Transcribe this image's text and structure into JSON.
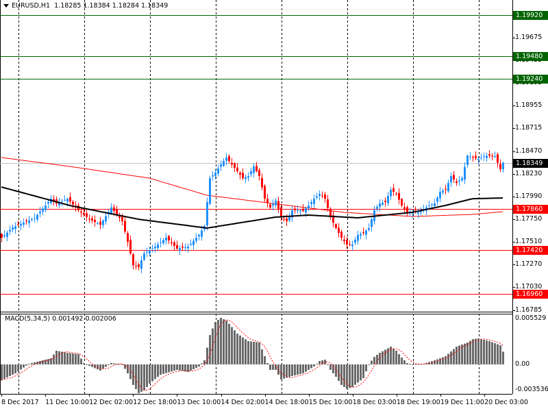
{
  "header": {
    "symbol": "EURUSD,H1",
    "ohlc": "1.18285 1.18384 1.18284 1.18349"
  },
  "chart_data": [
    {
      "type": "candlestick",
      "title": "EURUSD,H1",
      "ylim": [
        1.16785,
        1.1992
      ],
      "price_ticks": [
        "1.19675",
        "1.19435",
        "1.19195",
        "1.18955",
        "1.18715",
        "1.18470",
        "1.18230",
        "1.17990",
        "1.17750",
        "1.17510",
        "1.17270",
        "1.17030",
        "1.16785"
      ],
      "time_ticks": [
        "8 Dec 2017",
        "11 Dec 10:00",
        "12 Dec 02:00",
        "12 Dec 18:00",
        "13 Dec 10:00",
        "14 Dec 02:00",
        "14 Dec 18:00",
        "15 Dec 10:00",
        "18 Dec 03:00",
        "18 Dec 19:00",
        "19 Dec 11:00",
        "20 Dec 03:00"
      ],
      "last_price": {
        "value": 1.18349,
        "label": "1.18349",
        "color": "#000000"
      },
      "levels": [
        {
          "value": 1.1992,
          "label": "1.19920",
          "color": "#006400"
        },
        {
          "value": 1.1948,
          "label": "1.19480",
          "color": "#006400"
        },
        {
          "value": 1.1924,
          "label": "1.19240",
          "color": "#006400"
        },
        {
          "value": 1.1786,
          "label": "1.17860",
          "color": "#ff0000"
        },
        {
          "value": 1.1742,
          "label": "1.17420",
          "color": "#ff0000"
        },
        {
          "value": 1.1696,
          "label": "1.16960",
          "color": "#ff0000"
        }
      ],
      "up_color": "#1e90ff",
      "down_color": "#ff0000",
      "close_by_bar": [
        [
          0,
          1.17554
        ],
        [
          4,
          1.17663
        ],
        [
          8,
          1.17714
        ],
        [
          12,
          1.17765
        ],
        [
          16,
          1.17896
        ],
        [
          18,
          1.17968
        ],
        [
          20,
          1.17917
        ],
        [
          24,
          1.17968
        ],
        [
          28,
          1.17845
        ],
        [
          32,
          1.1775
        ],
        [
          36,
          1.17692
        ],
        [
          40,
          1.17874
        ],
        [
          44,
          1.17728
        ],
        [
          46,
          1.1751
        ],
        [
          48,
          1.17263
        ],
        [
          50,
          1.17241
        ],
        [
          52,
          1.17387
        ],
        [
          56,
          1.17459
        ],
        [
          60,
          1.17554
        ],
        [
          64,
          1.17438
        ],
        [
          68,
          1.17459
        ],
        [
          72,
          1.17583
        ],
        [
          74,
          1.17678
        ],
        [
          76,
          1.18186
        ],
        [
          78,
          1.18245
        ],
        [
          80,
          1.18332
        ],
        [
          82,
          1.18405
        ],
        [
          84,
          1.18332
        ],
        [
          86,
          1.18259
        ],
        [
          88,
          1.18186
        ],
        [
          90,
          1.18208
        ],
        [
          92,
          1.1831
        ],
        [
          94,
          1.18208
        ],
        [
          96,
          1.17968
        ],
        [
          98,
          1.17874
        ],
        [
          100,
          1.17947
        ],
        [
          102,
          1.17772
        ],
        [
          104,
          1.17728
        ],
        [
          106,
          1.17845
        ],
        [
          108,
          1.17845
        ],
        [
          110,
          1.17838
        ],
        [
          112,
          1.17896
        ],
        [
          114,
          1.17968
        ],
        [
          116,
          1.18019
        ],
        [
          118,
          1.17968
        ],
        [
          120,
          1.17772
        ],
        [
          122,
          1.17656
        ],
        [
          124,
          1.17554
        ],
        [
          126,
          1.17481
        ],
        [
          128,
          1.17481
        ],
        [
          130,
          1.17583
        ],
        [
          132,
          1.17605
        ],
        [
          134,
          1.17656
        ],
        [
          136,
          1.17845
        ],
        [
          138,
          1.17917
        ],
        [
          140,
          1.17932
        ],
        [
          142,
          1.18063
        ],
        [
          144,
          1.18019
        ],
        [
          146,
          1.17896
        ],
        [
          148,
          1.17823
        ],
        [
          150,
          1.17823
        ],
        [
          152,
          1.17823
        ],
        [
          154,
          1.17859
        ],
        [
          156,
          1.17896
        ],
        [
          158,
          1.17917
        ],
        [
          160,
          1.18041
        ],
        [
          162,
          1.18063
        ],
        [
          164,
          1.18208
        ],
        [
          166,
          1.18136
        ],
        [
          168,
          1.18186
        ],
        [
          170,
          1.18426
        ],
        [
          172,
          1.18405
        ],
        [
          174,
          1.1839
        ],
        [
          176,
          1.18419
        ],
        [
          178,
          1.18426
        ],
        [
          180,
          1.18419
        ],
        [
          182,
          1.18281
        ],
        [
          183,
          1.18349
        ]
      ],
      "ma_black": {
        "color": "#000000",
        "points": [
          [
            0,
            1.18092
          ],
          [
            25,
            1.17896
          ],
          [
            50,
            1.1775
          ],
          [
            75,
            1.17656
          ],
          [
            100,
            1.17772
          ],
          [
            112,
            1.17794
          ],
          [
            130,
            1.17765
          ],
          [
            150,
            1.17823
          ],
          [
            162,
            1.17896
          ],
          [
            172,
            1.17968
          ],
          [
            183,
            1.17976
          ]
        ]
      },
      "ma_red": {
        "color": "#ff0000",
        "points": [
          [
            0,
            1.18405
          ],
          [
            25,
            1.1831
          ],
          [
            54,
            1.18186
          ],
          [
            75,
            1.18005
          ],
          [
            105,
            1.17896
          ],
          [
            125,
            1.17823
          ],
          [
            150,
            1.17779
          ],
          [
            172,
            1.17801
          ],
          [
            183,
            1.1783
          ]
        ]
      }
    },
    {
      "type": "bar",
      "title": "MACD(5,34,5) 0.001492 0.002006",
      "ylim": [
        -0.003536,
        0.005529
      ],
      "ticks": [
        "0.005529",
        "0.00",
        "-0.003536"
      ],
      "histogram_color": "#696969",
      "signal_color": "#ff0000",
      "histogram_by_bar": [
        [
          0,
          -0.00184
        ],
        [
          5,
          -0.00104
        ],
        [
          10,
          8e-05
        ],
        [
          14,
          0.0004
        ],
        [
          18,
          0.00072
        ],
        [
          20,
          0.0016
        ],
        [
          24,
          0.00136
        ],
        [
          28,
          0.0012
        ],
        [
          30,
          0.00016
        ],
        [
          32,
          -0.00016
        ],
        [
          36,
          -0.00072
        ],
        [
          40,
          0.00016
        ],
        [
          44,
          0
        ],
        [
          46,
          -0.00104
        ],
        [
          48,
          -0.0024
        ],
        [
          50,
          -0.00336
        ],
        [
          52,
          -0.00304
        ],
        [
          54,
          -0.00224
        ],
        [
          58,
          -0.0012
        ],
        [
          64,
          -0.00064
        ],
        [
          68,
          -0.00088
        ],
        [
          72,
          -0.00024
        ],
        [
          74,
          0.00048
        ],
        [
          76,
          0.00344
        ],
        [
          78,
          0.00497
        ],
        [
          80,
          0.00545
        ],
        [
          82,
          0.00513
        ],
        [
          86,
          0.0036
        ],
        [
          90,
          0.00272
        ],
        [
          94,
          0.00256
        ],
        [
          96,
          0.00096
        ],
        [
          98,
          -0.00064
        ],
        [
          100,
          -0.00064
        ],
        [
          102,
          -0.00176
        ],
        [
          106,
          -0.00136
        ],
        [
          110,
          -0.00104
        ],
        [
          114,
          -0.00024
        ],
        [
          116,
          0.0004
        ],
        [
          118,
          0.00056
        ],
        [
          120,
          -0.00064
        ],
        [
          122,
          -0.00144
        ],
        [
          124,
          -0.0024
        ],
        [
          126,
          -0.00288
        ],
        [
          128,
          -0.00264
        ],
        [
          132,
          -0.0016
        ],
        [
          134,
          0
        ],
        [
          136,
          0.00088
        ],
        [
          138,
          0.00136
        ],
        [
          142,
          0.00208
        ],
        [
          144,
          0.0016
        ],
        [
          146,
          0.0008
        ],
        [
          148,
          0.00016
        ],
        [
          150,
          0
        ],
        [
          154,
          8e-05
        ],
        [
          158,
          0.00048
        ],
        [
          162,
          0.00096
        ],
        [
          166,
          0.00208
        ],
        [
          170,
          0.00256
        ],
        [
          172,
          0.00296
        ],
        [
          174,
          0.00304
        ],
        [
          178,
          0.00272
        ],
        [
          182,
          0.00224
        ],
        [
          183,
          0.001492
        ]
      ],
      "signal_last": 0.002006
    }
  ]
}
